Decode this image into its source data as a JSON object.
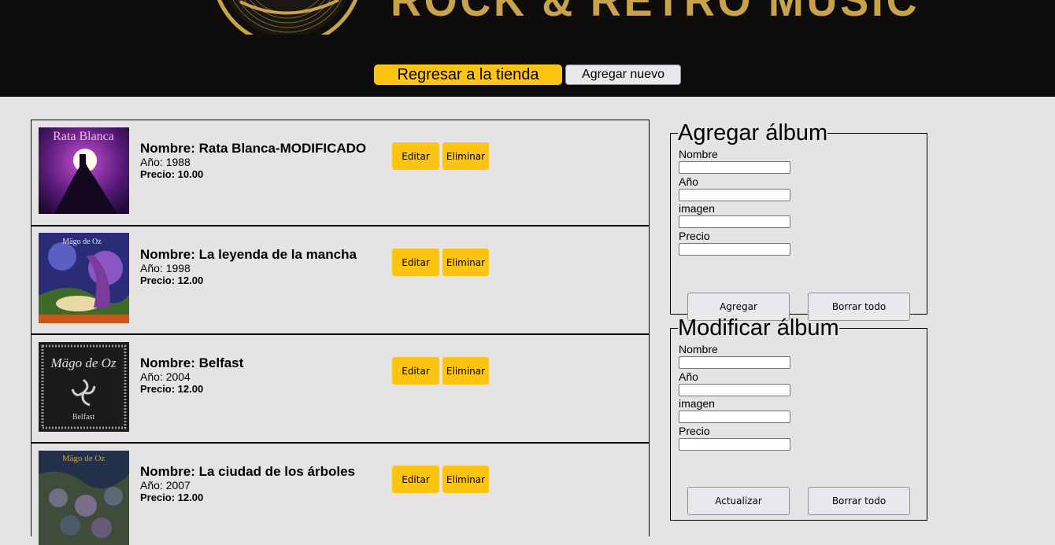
{
  "header": {
    "logo_text": "ROCK & RETRO MUSIC",
    "back_to_store": "Regresar a la tienda",
    "add_new": "Agregar nuevo"
  },
  "albums": [
    {
      "name": "Nombre: Rata Blanca-MODIFICADO",
      "year": "Año: 1988",
      "price": "Precio: 10.00",
      "cover_title": "Rata Blanca",
      "edit": "Editar",
      "delete": "Eliminar"
    },
    {
      "name": "Nombre: La leyenda de la mancha",
      "year": "Año: 1998",
      "price": "Precio: 12.00",
      "cover_title": "Mägo de Oz",
      "edit": "Editar",
      "delete": "Eliminar"
    },
    {
      "name": "Nombre: Belfast",
      "year": "Año: 2004",
      "price": "Precio: 12.00",
      "cover_title": "Mägo de Oz",
      "cover_subtitle": "Belfast",
      "edit": "Editar",
      "delete": "Eliminar"
    },
    {
      "name": "Nombre: La ciudad de los árboles",
      "year": "Año: 2007",
      "price": "Precio: 12.00",
      "cover_title": "Mägo de Oz",
      "edit": "Editar",
      "delete": "Eliminar"
    }
  ],
  "add_form": {
    "legend": "Agregar álbum",
    "fields": [
      "Nombre",
      "Año",
      "imagen",
      "Precio"
    ],
    "submit": "Agregar",
    "clear": "Borrar todo"
  },
  "edit_form": {
    "legend": "Modificar álbum",
    "fields": [
      "Nombre",
      "Año",
      "imagen",
      "Precio"
    ],
    "submit": "Actualizar",
    "clear": "Borrar todo"
  },
  "colors": {
    "header_bg": "#0e0d0b",
    "gold": "#c9a24a",
    "accent_yellow": "#fdc511",
    "page_bg": "#e5e3e4"
  }
}
